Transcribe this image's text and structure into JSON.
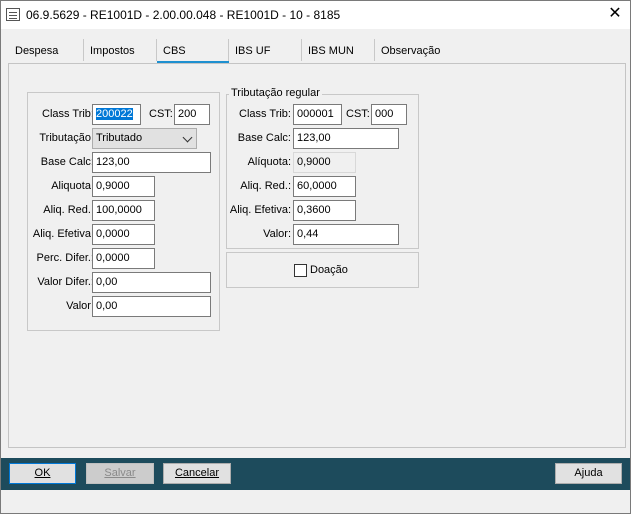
{
  "window": {
    "title": "06.9.5629 - RE1001D - 2.00.00.048 - RE1001D - 10 - 8185",
    "close_symbol": "✕"
  },
  "tabs": [
    {
      "label": "Despesa"
    },
    {
      "label": "Impostos"
    },
    {
      "label": "CBS",
      "active": true
    },
    {
      "label": "IBS UF"
    },
    {
      "label": "IBS MUN"
    },
    {
      "label": "Observação"
    }
  ],
  "left": {
    "class_trib_label": "Class Trib:",
    "class_trib_value": "200022",
    "cst_label": "CST:",
    "cst_value": "200",
    "tributacao_label": "Tributação:",
    "tributacao_value": "Tributado",
    "base_calc_label": "Base Calc:",
    "base_calc_value": "123,00",
    "aliquota_label": "Aliquota:",
    "aliquota_value": "0,9000",
    "aliq_red_label": "Aliq. Red.:",
    "aliq_red_value": "100,0000",
    "aliq_efetiva_label": "Aliq. Efetiva:",
    "aliq_efetiva_value": "0,0000",
    "perc_difer_label": "Perc. Difer.:",
    "perc_difer_value": "0,0000",
    "valor_difer_label": "Valor Difer.:",
    "valor_difer_value": "0,00",
    "valor_label": "Valor:",
    "valor_value": "0,00"
  },
  "regular": {
    "title": "Tributação regular",
    "class_trib_label": "Class Trib:",
    "class_trib_value": "000001",
    "cst_label": "CST:",
    "cst_value": "000",
    "base_calc_label": "Base Calc:",
    "base_calc_value": "123,00",
    "aliquota_label": "Alíquota:",
    "aliquota_value": "0,9000",
    "aliq_red_label": "Aliq. Red.:",
    "aliq_red_value": "60,0000",
    "aliq_efetiva_label": "Aliq. Efetiva:",
    "aliq_efetiva_value": "0,3600",
    "valor_label": "Valor:",
    "valor_value": "0,44"
  },
  "doacao": {
    "label": "Doação",
    "checked": false
  },
  "buttons": {
    "ok": "OK",
    "salvar": "Salvar",
    "cancelar": "Cancelar",
    "ajuda": "Ajuda"
  },
  "colors": {
    "bottom_bar": "#1d4b5c",
    "active_tab_underline": "#1e90d0",
    "selection": "#0078d7"
  }
}
